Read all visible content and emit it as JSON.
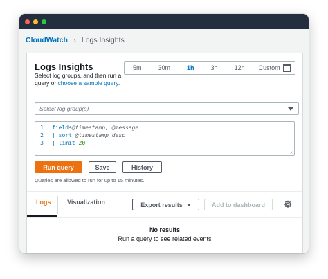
{
  "breadcrumb": {
    "root": "CloudWatch",
    "current": "Logs Insights"
  },
  "header": {
    "title": "Logs Insights",
    "subtitle_prefix": "Select log groups, and then run a query or ",
    "subtitle_link": "choose a sample query",
    "subtitle_suffix": "."
  },
  "time_range": {
    "options": [
      "5m",
      "30m",
      "1h",
      "3h",
      "12h"
    ],
    "selected": "1h",
    "custom_label": "Custom"
  },
  "log_group_select": {
    "placeholder": "Select log group(s)"
  },
  "editor": {
    "lines": [
      {
        "n": "1",
        "kw": "fields",
        "rest": " @timestamp, @message"
      },
      {
        "n": "2",
        "pre": "| ",
        "kw": "sort",
        "rest": " @timestamp desc"
      },
      {
        "n": "3",
        "pre": "| ",
        "kw": "limit",
        "num": " 20"
      }
    ]
  },
  "actions": {
    "run": "Run query",
    "save": "Save",
    "history": "History"
  },
  "note": "Queries are allowed to run for up to 15 minutes.",
  "results": {
    "tabs": [
      "Logs",
      "Visualization"
    ],
    "active_tab": "Logs",
    "export": "Export results",
    "add_dashboard": "Add to dashboard",
    "empty_title": "No results",
    "empty_sub": "Run a query to see related events"
  },
  "colors": {
    "accent": "#ec7211",
    "link": "#0073bb",
    "titlebar": "#232f3e"
  }
}
